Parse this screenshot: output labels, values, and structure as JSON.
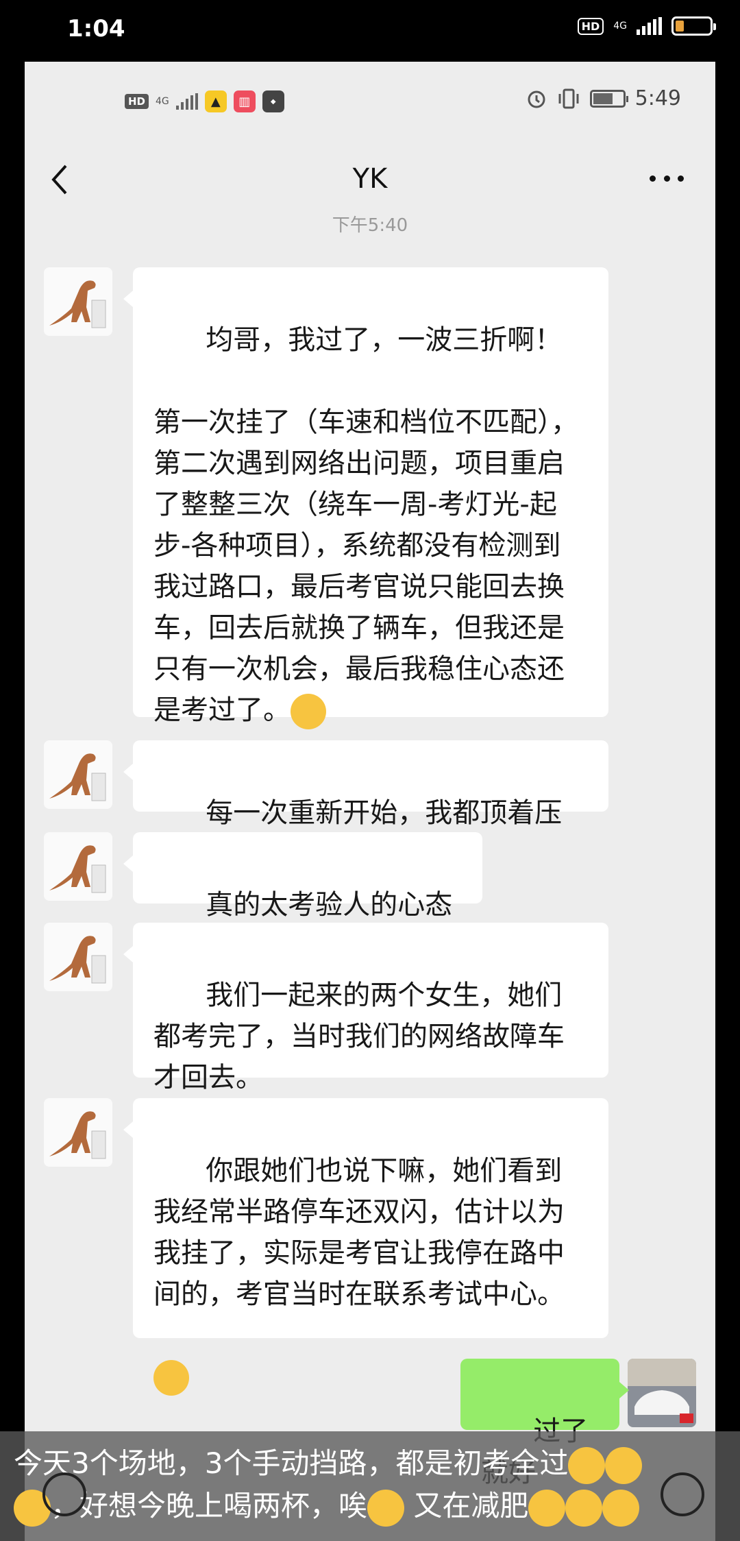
{
  "phone_status": {
    "time": "1:04",
    "hd": "HD",
    "network": "4G",
    "battery_level": 0.25
  },
  "inner_status": {
    "hd": "HD",
    "network": "4G",
    "time": "5:49"
  },
  "chat": {
    "title": "YK",
    "timestamp": "下午5:40",
    "messages": [
      {
        "sender": "YK",
        "side": "left",
        "text": "均哥，我过了，一波三折啊！\n\n第一次挂了（车速和档位不匹配），第二次遇到网络出问题，项目重启了整整三次（绕车一周-考灯光-起步-各种项目），系统都没有检测到我过路口，最后考官说只能回去换车，回去后就换了辆车，但我还是只有一次机会，最后我稳住心态还是考过了。",
        "emoji": "grinning-face"
      },
      {
        "sender": "YK",
        "side": "left",
        "text": "每一次重新开始，我都顶着压力。"
      },
      {
        "sender": "YK",
        "side": "left",
        "text": "真的太考验人的心态了。"
      },
      {
        "sender": "YK",
        "side": "left",
        "text": "我们一起来的两个女生，她们都考完了，当时我们的网络故障车才回去。"
      },
      {
        "sender": "YK",
        "side": "left",
        "text": "你跟她们也说下嘛，她们看到我经常半路停车还双闪，估计以为我挂了，实际是考官让我停在路中间的，考官当时在联系考试中心。",
        "emoji": "tears-of-joy"
      },
      {
        "sender": "me",
        "side": "right",
        "text": "过了就好"
      }
    ]
  },
  "caption": {
    "line1": "今天3个场地，3个手动挡路，都是初考全过",
    "line2": "，好想今晚上喝两杯，唉",
    "line3": " 又在减肥",
    "emojis_line1": [
      "sunglasses-face",
      "sunglasses-face"
    ],
    "emojis_line2": [
      "sunglasses-face",
      "pensive-face",
      "loudly-crying-face",
      "loudly-crying-face",
      "loudly-crying-face"
    ]
  },
  "colors": {
    "chat_bg": "#ededed",
    "bubble_in": "#ffffff",
    "bubble_out": "#95ec69"
  }
}
